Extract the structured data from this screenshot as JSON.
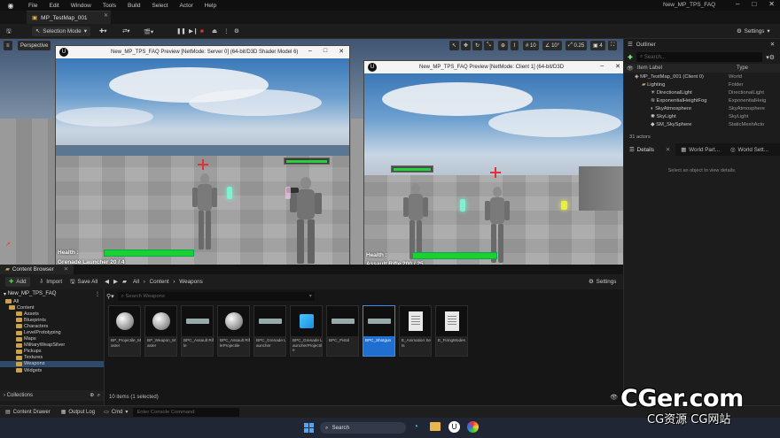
{
  "menubar": {
    "items": [
      "File",
      "Edit",
      "Window",
      "Tools",
      "Build",
      "Select",
      "Actor",
      "Help"
    ],
    "window_title": "New_MP_TPS_FAQ"
  },
  "level_tab": {
    "label": "MP_TestMap_001"
  },
  "toolbar": {
    "selection_mode": "Selection Mode",
    "settings": "Settings"
  },
  "viewport": {
    "perspective": "Perspective",
    "grid_snap": "10",
    "rotation_snap": "10°",
    "scale_snap": "0.25",
    "camera_speed": "4"
  },
  "pie_server": {
    "title": "New_MP_TPS_FAQ Preview [NetMode: Server 0]  (64-bit/D3D Shader Model 6)",
    "health_label": "Health :",
    "weapon_label": "Grenade Launcher  20 / 4",
    "health_fraction": 0.93
  },
  "pie_client": {
    "title": "New_MP_TPS_FAQ Preview [NetMode: Client 1]  (64-bit/D3D",
    "health_label": "Health :",
    "weapon_label": "Assault Rifle 200 / 25",
    "health_fraction": 0.93
  },
  "outliner": {
    "title": "Outliner",
    "search_placeholder": "Search...",
    "col_label": "Item Label",
    "col_type": "Type",
    "rows": [
      {
        "label": "MP_TestMap_001 (Client 0)",
        "type": "World"
      },
      {
        "label": "Lighting",
        "type": "Folder"
      },
      {
        "label": "DirectionalLight",
        "type": "DirectionalLight"
      },
      {
        "label": "ExponentialHeightFog",
        "type": "ExponentialHeig"
      },
      {
        "label": "SkyAtmosphere",
        "type": "SkyAtmosphere"
      },
      {
        "label": "SkyLight",
        "type": "SkyLight"
      },
      {
        "label": "SM_SkySphere",
        "type": "StaticMeshActo"
      }
    ],
    "actor_count": "31 actors"
  },
  "details": {
    "tabs": [
      "Details",
      "World Partition",
      "World Settings"
    ],
    "tab_labels_short": [
      "Details",
      "World Part...",
      "World Sett..."
    ],
    "empty_text": "Select an object to view details."
  },
  "content_browser": {
    "tab_label": "Content Browser",
    "add": "Add",
    "import": "Import",
    "save_all": "Save All",
    "path": [
      "All",
      "Content",
      "Weapons"
    ],
    "settings": "Settings",
    "search_placeholder": "Search Weapons",
    "project": "New_MP_TPS_FAQ",
    "tree": [
      {
        "label": "All",
        "depth": 0
      },
      {
        "label": "Content",
        "depth": 1
      },
      {
        "label": "Assets",
        "depth": 2
      },
      {
        "label": "Blueprints",
        "depth": 2
      },
      {
        "label": "Characters",
        "depth": 2
      },
      {
        "label": "LevelPrototyping",
        "depth": 2
      },
      {
        "label": "Maps",
        "depth": 2
      },
      {
        "label": "MilitaryWeapSilver",
        "depth": 2
      },
      {
        "label": "Pickups",
        "depth": 2
      },
      {
        "label": "Textures",
        "depth": 2
      },
      {
        "label": "Weapons",
        "depth": 2,
        "selected": true
      },
      {
        "label": "Widgets",
        "depth": 2
      }
    ],
    "collections": "Collections",
    "assets": [
      {
        "name": "BP_Projectile_Master",
        "thumb": "sphere"
      },
      {
        "name": "BP_Weapon_Master",
        "thumb": "sphere"
      },
      {
        "name": "BPC_Assault Rifle",
        "thumb": "gun"
      },
      {
        "name": "BPC_Assault RifleProjectile",
        "thumb": "sphere"
      },
      {
        "name": "BPC_Grenade Launcher",
        "thumb": "gun"
      },
      {
        "name": "BPC_Grenade LauncherProjectile",
        "thumb": "cube"
      },
      {
        "name": "BPC_Pistol",
        "thumb": "gun"
      },
      {
        "name": "BPC_Shotgun",
        "thumb": "gun",
        "selected": true
      },
      {
        "name": "E_Animation Sets",
        "thumb": "doc"
      },
      {
        "name": "E_FiringModes",
        "thumb": "doc"
      }
    ],
    "item_count": "10 items (1 selected)"
  },
  "statusbar": {
    "content_drawer": "Content Drawer",
    "output_log": "Output Log",
    "cmd": "Cmd",
    "console_placeholder": "Enter Console Command"
  },
  "taskbar": {
    "search": "Search"
  },
  "watermark": {
    "big": "CGer.com",
    "small": "CG资源 CG网站"
  }
}
